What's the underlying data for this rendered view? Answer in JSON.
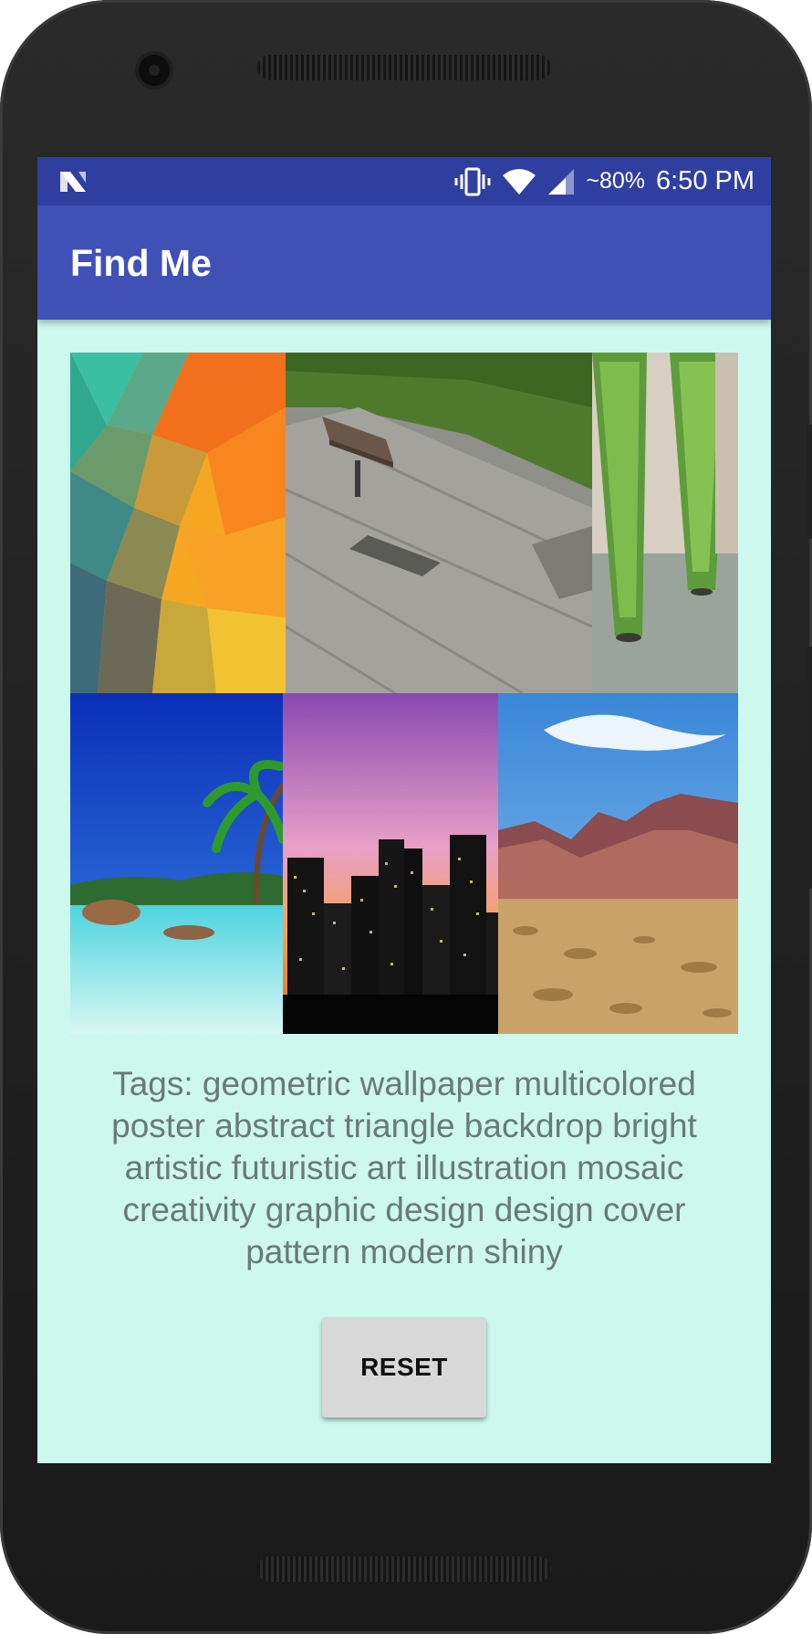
{
  "status_bar": {
    "notification_icon": "android-n-icon",
    "icons": [
      "vibrate-icon",
      "wifi-icon",
      "signal-icon"
    ],
    "battery": "~80%",
    "time": "6:50 PM"
  },
  "app_bar": {
    "title": "Find Me"
  },
  "image_grid": {
    "images": [
      {
        "name": "geometric-wallpaper-image",
        "subject": "abstract triangle mosaic"
      },
      {
        "name": "park-bench-image",
        "subject": "wooden bench on stone steps"
      },
      {
        "name": "plant-columns-image",
        "subject": "vine-covered columns"
      },
      {
        "name": "tropical-beach-image",
        "subject": "palm tree and lagoon"
      },
      {
        "name": "city-skyline-image",
        "subject": "night skyline with pink sky"
      },
      {
        "name": "desert-mountains-image",
        "subject": "desert and mountains"
      }
    ]
  },
  "tags": {
    "text": "Tags: geometric wallpaper multicolored poster abstract triangle backdrop bright artistic futuristic art illustration mosaic creativity graphic design design cover pattern modern shiny"
  },
  "reset_button": {
    "label": "RESET"
  },
  "colors": {
    "status_bar": "#303f9f",
    "app_bar": "#3f51b5",
    "background": "#ccf8ee",
    "tag_text": "#6a7a76",
    "button": "#d8d8d8"
  }
}
